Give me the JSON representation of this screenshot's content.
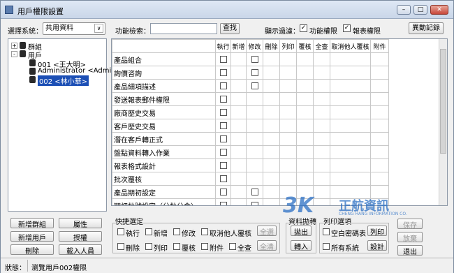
{
  "window": {
    "title": "用戶權限設置"
  },
  "left": {
    "system_label": "選擇系統：",
    "system_value": "共用資料",
    "tree": [
      {
        "label": "群組",
        "expander": "+"
      },
      {
        "label": "用戶",
        "expander": "-"
      },
      {
        "label": "001 <王大明>"
      },
      {
        "label": "Administrator <Admin>"
      },
      {
        "label": "002 <林小華>"
      }
    ],
    "buttons": {
      "add_group": "新增群組",
      "properties": "屬性",
      "add_user": "新增用戶",
      "authorize": "授權",
      "delete": "刪除",
      "import": "載入人員"
    }
  },
  "toolbar": {
    "search_label": "功能檢索：",
    "search_value": "",
    "search_button": "查找",
    "filter_label": "顯示過濾：",
    "filter_func": "功能權限",
    "filter_report": "報表權限",
    "change_log": "異動記錄"
  },
  "grid": {
    "columns": [
      "執行",
      "新增",
      "修改",
      "刪除",
      "列印",
      "覆核",
      "全查",
      "取消他人覆核",
      "附件"
    ],
    "rows": [
      {
        "name": "產品組合",
        "checks": [
          true,
          false,
          true
        ]
      },
      {
        "name": "詢價咨詢",
        "checks": [
          true,
          false,
          true
        ]
      },
      {
        "name": "產品細項描述",
        "checks": [
          true,
          false,
          true
        ]
      },
      {
        "name": "發送報表郵件權限",
        "checks": [
          true,
          false,
          false
        ]
      },
      {
        "name": "廠商歷史交易",
        "checks": [
          true,
          false,
          false
        ]
      },
      {
        "name": "客戶歷史交易",
        "checks": [
          true,
          false,
          false
        ]
      },
      {
        "name": "潛在客戶轉正式",
        "checks": [
          true,
          false,
          false
        ]
      },
      {
        "name": "盤點資料轉入作業",
        "checks": [
          true,
          false,
          false
        ]
      },
      {
        "name": "報表格式設計",
        "checks": [
          true,
          false,
          false
        ]
      },
      {
        "name": "批次覆核",
        "checks": [
          true,
          false,
          false
        ]
      },
      {
        "name": "產品期初設定",
        "checks": [
          true,
          false,
          true
        ]
      },
      {
        "name": "期初批號設定（分批分倉）",
        "checks": [
          true,
          false,
          true
        ]
      }
    ]
  },
  "quick": {
    "title": "快捷選定",
    "row1": [
      "執行",
      "新增",
      "修改",
      "取消他人覆核"
    ],
    "row2": [
      "刪除",
      "列印",
      "覆核",
      "附件",
      "全查"
    ],
    "select_all": "全選",
    "clear_all": "全清"
  },
  "transfer": {
    "title": "資料拋轉",
    "export": "拋出",
    "import": "轉入"
  },
  "print": {
    "title": "列印選項",
    "blank_password": "空白密碼表",
    "print_btn": "列印",
    "all_systems": "所有系統",
    "setup": "設計"
  },
  "actions": {
    "save": "保存",
    "discard": "放棄",
    "exit": "退出"
  },
  "status": {
    "label": "狀態：",
    "text": "瀏覽用戶002權限"
  },
  "watermark": {
    "mark": "3K",
    "cn": "正航資訊",
    "en": "CHENG HANG INFORMATION CO."
  }
}
